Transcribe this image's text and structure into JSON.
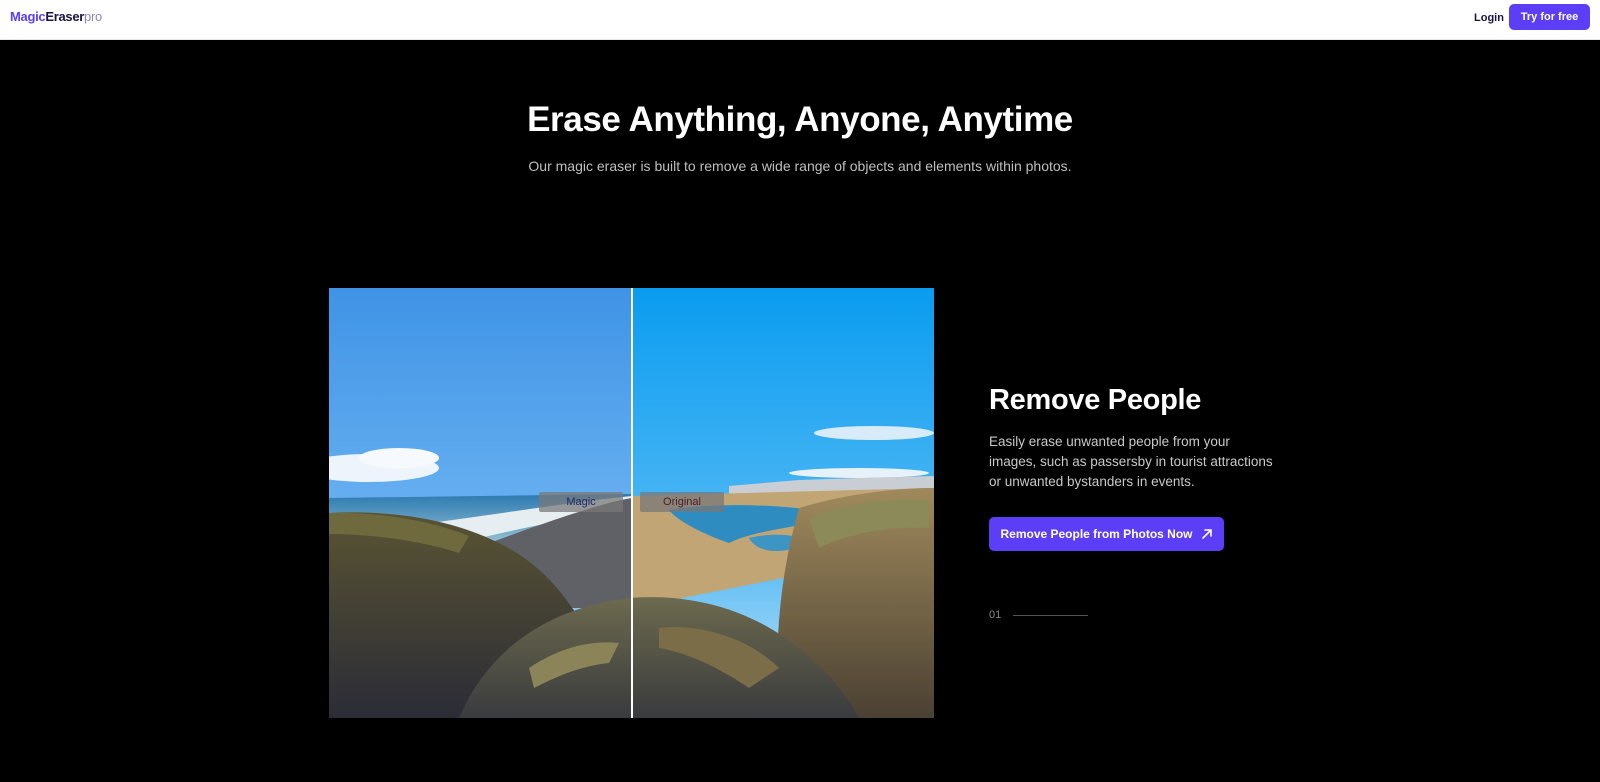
{
  "header": {
    "logo": {
      "part1": "Magic",
      "part2": "Eraser",
      "part3": "pro"
    },
    "login_label": "Login",
    "try_label": "Try for free"
  },
  "hero": {
    "title": "Erase Anything, Anyone, Anytime",
    "subtitle": "Our magic eraser is built to remove a wide range of objects and elements within photos."
  },
  "comparison": {
    "left_label": "Magic",
    "right_label": "Original"
  },
  "feature": {
    "title": "Remove People",
    "description": "Easily erase unwanted people from your images, such as passersby in tourist attractions or unwanted bystanders in events.",
    "cta_label": "Remove People from Photos Now",
    "cta_icon": "arrow-up-right-icon",
    "index": "01"
  },
  "colors": {
    "accent": "#5b3ef5",
    "background": "#000000",
    "header_bg": "#ffffff"
  }
}
